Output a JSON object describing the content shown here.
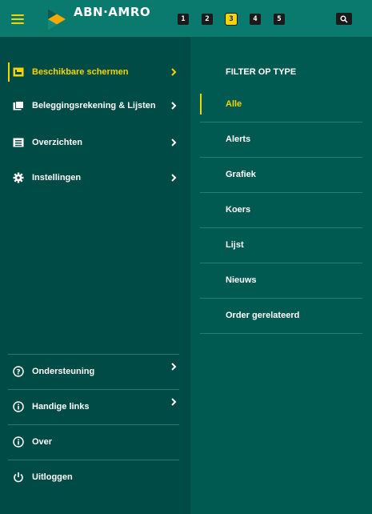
{
  "header": {
    "logo_text": "ABN·AMRO",
    "screen_buttons": [
      "1",
      "2",
      "3",
      "4",
      "5"
    ],
    "active_screen": "3",
    "colors": {
      "bar": "#0b7a6e",
      "accent": "#f5d400"
    }
  },
  "menu": {
    "items": [
      {
        "label": "Beschikbare schermen",
        "icon": "screens-icon",
        "active": true
      },
      {
        "label": "Beleggingsrekening & Lijsten",
        "icon": "portfolio-icon",
        "active": false
      },
      {
        "label": "Overzichten",
        "icon": "overview-icon",
        "active": false
      },
      {
        "label": "Instellingen",
        "icon": "gear-icon",
        "active": false
      }
    ],
    "bottom_items": [
      {
        "label": "Ondersteuning",
        "icon": "question-icon"
      },
      {
        "label": "Handige links",
        "icon": "info-icon"
      },
      {
        "label": "Over",
        "icon": "info-icon"
      },
      {
        "label": "Uitloggen",
        "icon": "power-icon"
      }
    ]
  },
  "filter": {
    "title": "FILTER OP TYPE",
    "items": [
      "Alle",
      "Alerts",
      "Grafiek",
      "Koers",
      "Lijst",
      "Nieuws",
      "Order gerelateerd"
    ],
    "active": "Alle"
  }
}
